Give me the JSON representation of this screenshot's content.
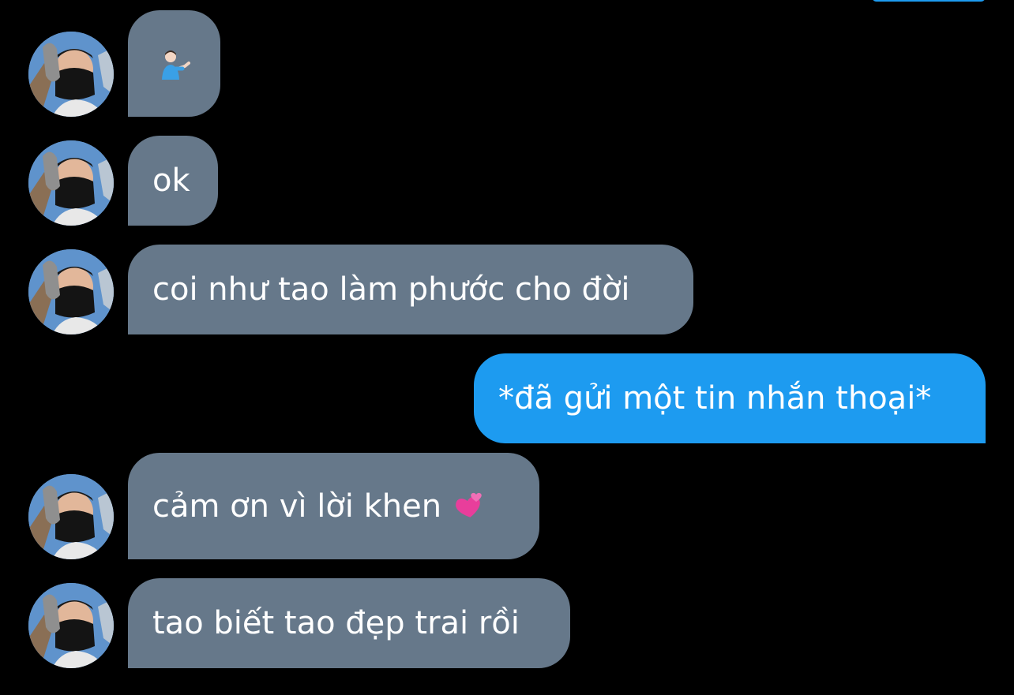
{
  "conversation": {
    "messages": [
      {
        "direction": "incoming",
        "text": "",
        "emoji": "man-tipping-hand-emoji"
      },
      {
        "direction": "incoming",
        "text": "ok"
      },
      {
        "direction": "incoming",
        "text": "coi như tao làm phước cho đời"
      },
      {
        "direction": "outgoing",
        "text": "*đã gửi một tin nhắn thoại*"
      },
      {
        "direction": "incoming",
        "text": "cảm ơn vì lời khen",
        "emoji": "two-hearts-emoji"
      },
      {
        "direction": "incoming",
        "text": "tao biết tao đẹp trai rồi"
      }
    ]
  },
  "colors": {
    "background": "#000000",
    "incoming_bubble": "#66788a",
    "outgoing_bubble": "#1d9bf0",
    "text": "#ffffff"
  }
}
